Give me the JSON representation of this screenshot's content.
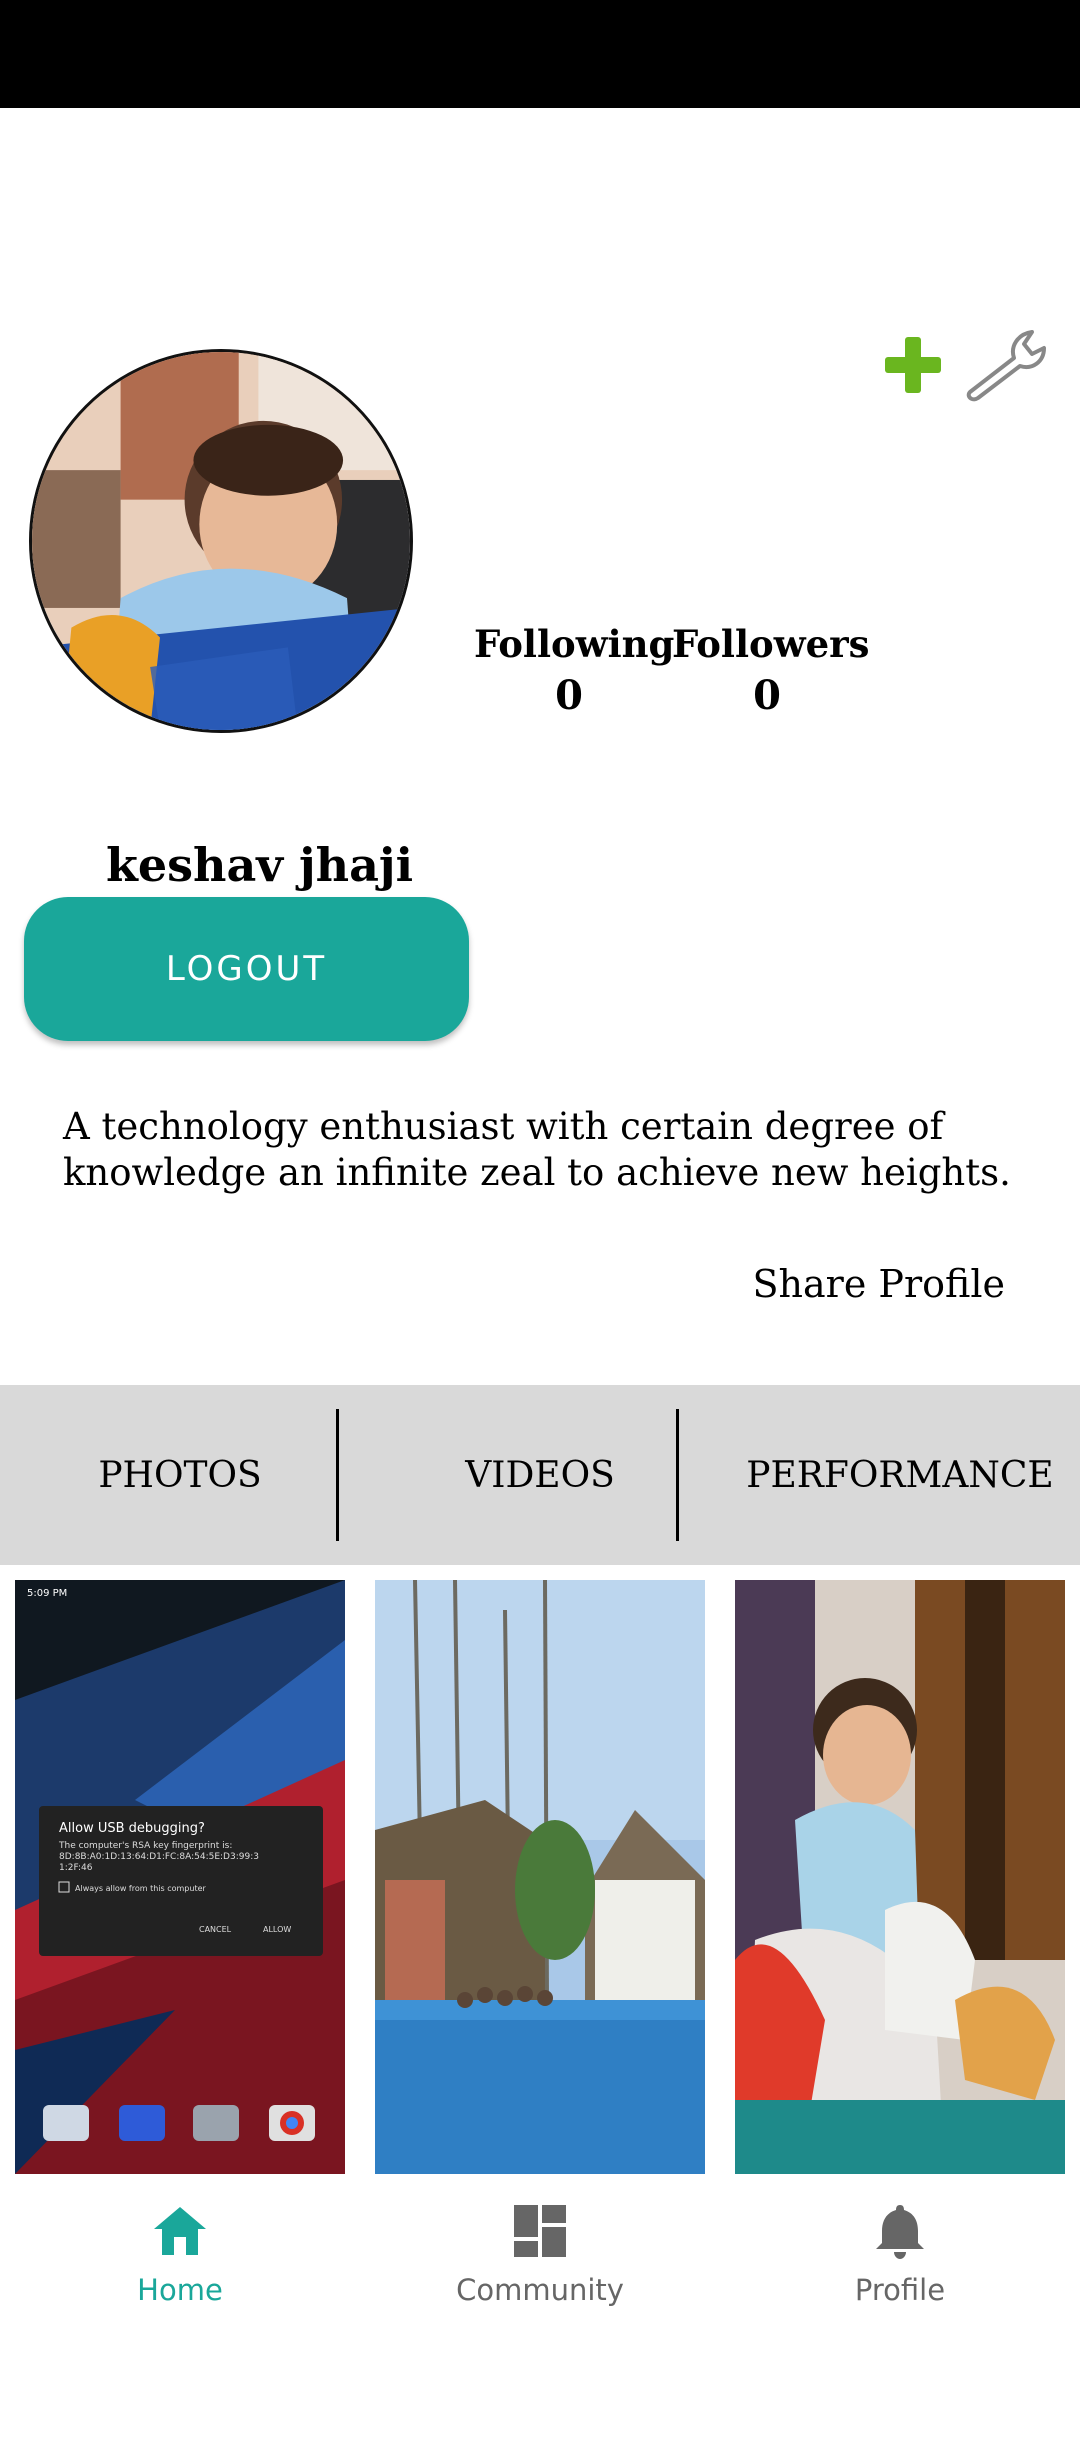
{
  "header": {
    "add_icon": "plus-icon",
    "settings_icon": "wrench-icon",
    "accent_add": "#6ab61f"
  },
  "profile": {
    "username": "keshav jhaji",
    "following_label": "Following",
    "following_count": "0",
    "followers_label": "Followers",
    "followers_count": "0",
    "logout_label": "LOGOUT",
    "bio": "A technology enthusiast with certain degree of knowledge an infinite zeal to achieve new heights.",
    "share_label": "Share Profile"
  },
  "tabs": [
    {
      "label": "PHOTOS"
    },
    {
      "label": "VIDEOS"
    },
    {
      "label": "PERFORMANCE"
    }
  ],
  "thumbnail1": {
    "status_time": "5:09 PM",
    "dialog_title": "Allow USB debugging?",
    "dialog_text": "The computer's RSA key fingerprint is:",
    "fingerprint_1": "8D:8B:A0:1D:13:64:D1:FC:8A:54:5E:D3:99:3",
    "fingerprint_2": "1:2F:46",
    "checkbox_label": "Always allow from this computer",
    "cancel_label": "CANCEL",
    "allow_label": "ALLOW"
  },
  "bottom_nav": [
    {
      "label": "Home",
      "icon": "home-icon"
    },
    {
      "label": "Community",
      "icon": "dashboard-icon"
    },
    {
      "label": "Profile",
      "icon": "bell-icon"
    }
  ],
  "colors": {
    "accent": "#1aa79a",
    "tab_bg": "#d9d9d9"
  }
}
